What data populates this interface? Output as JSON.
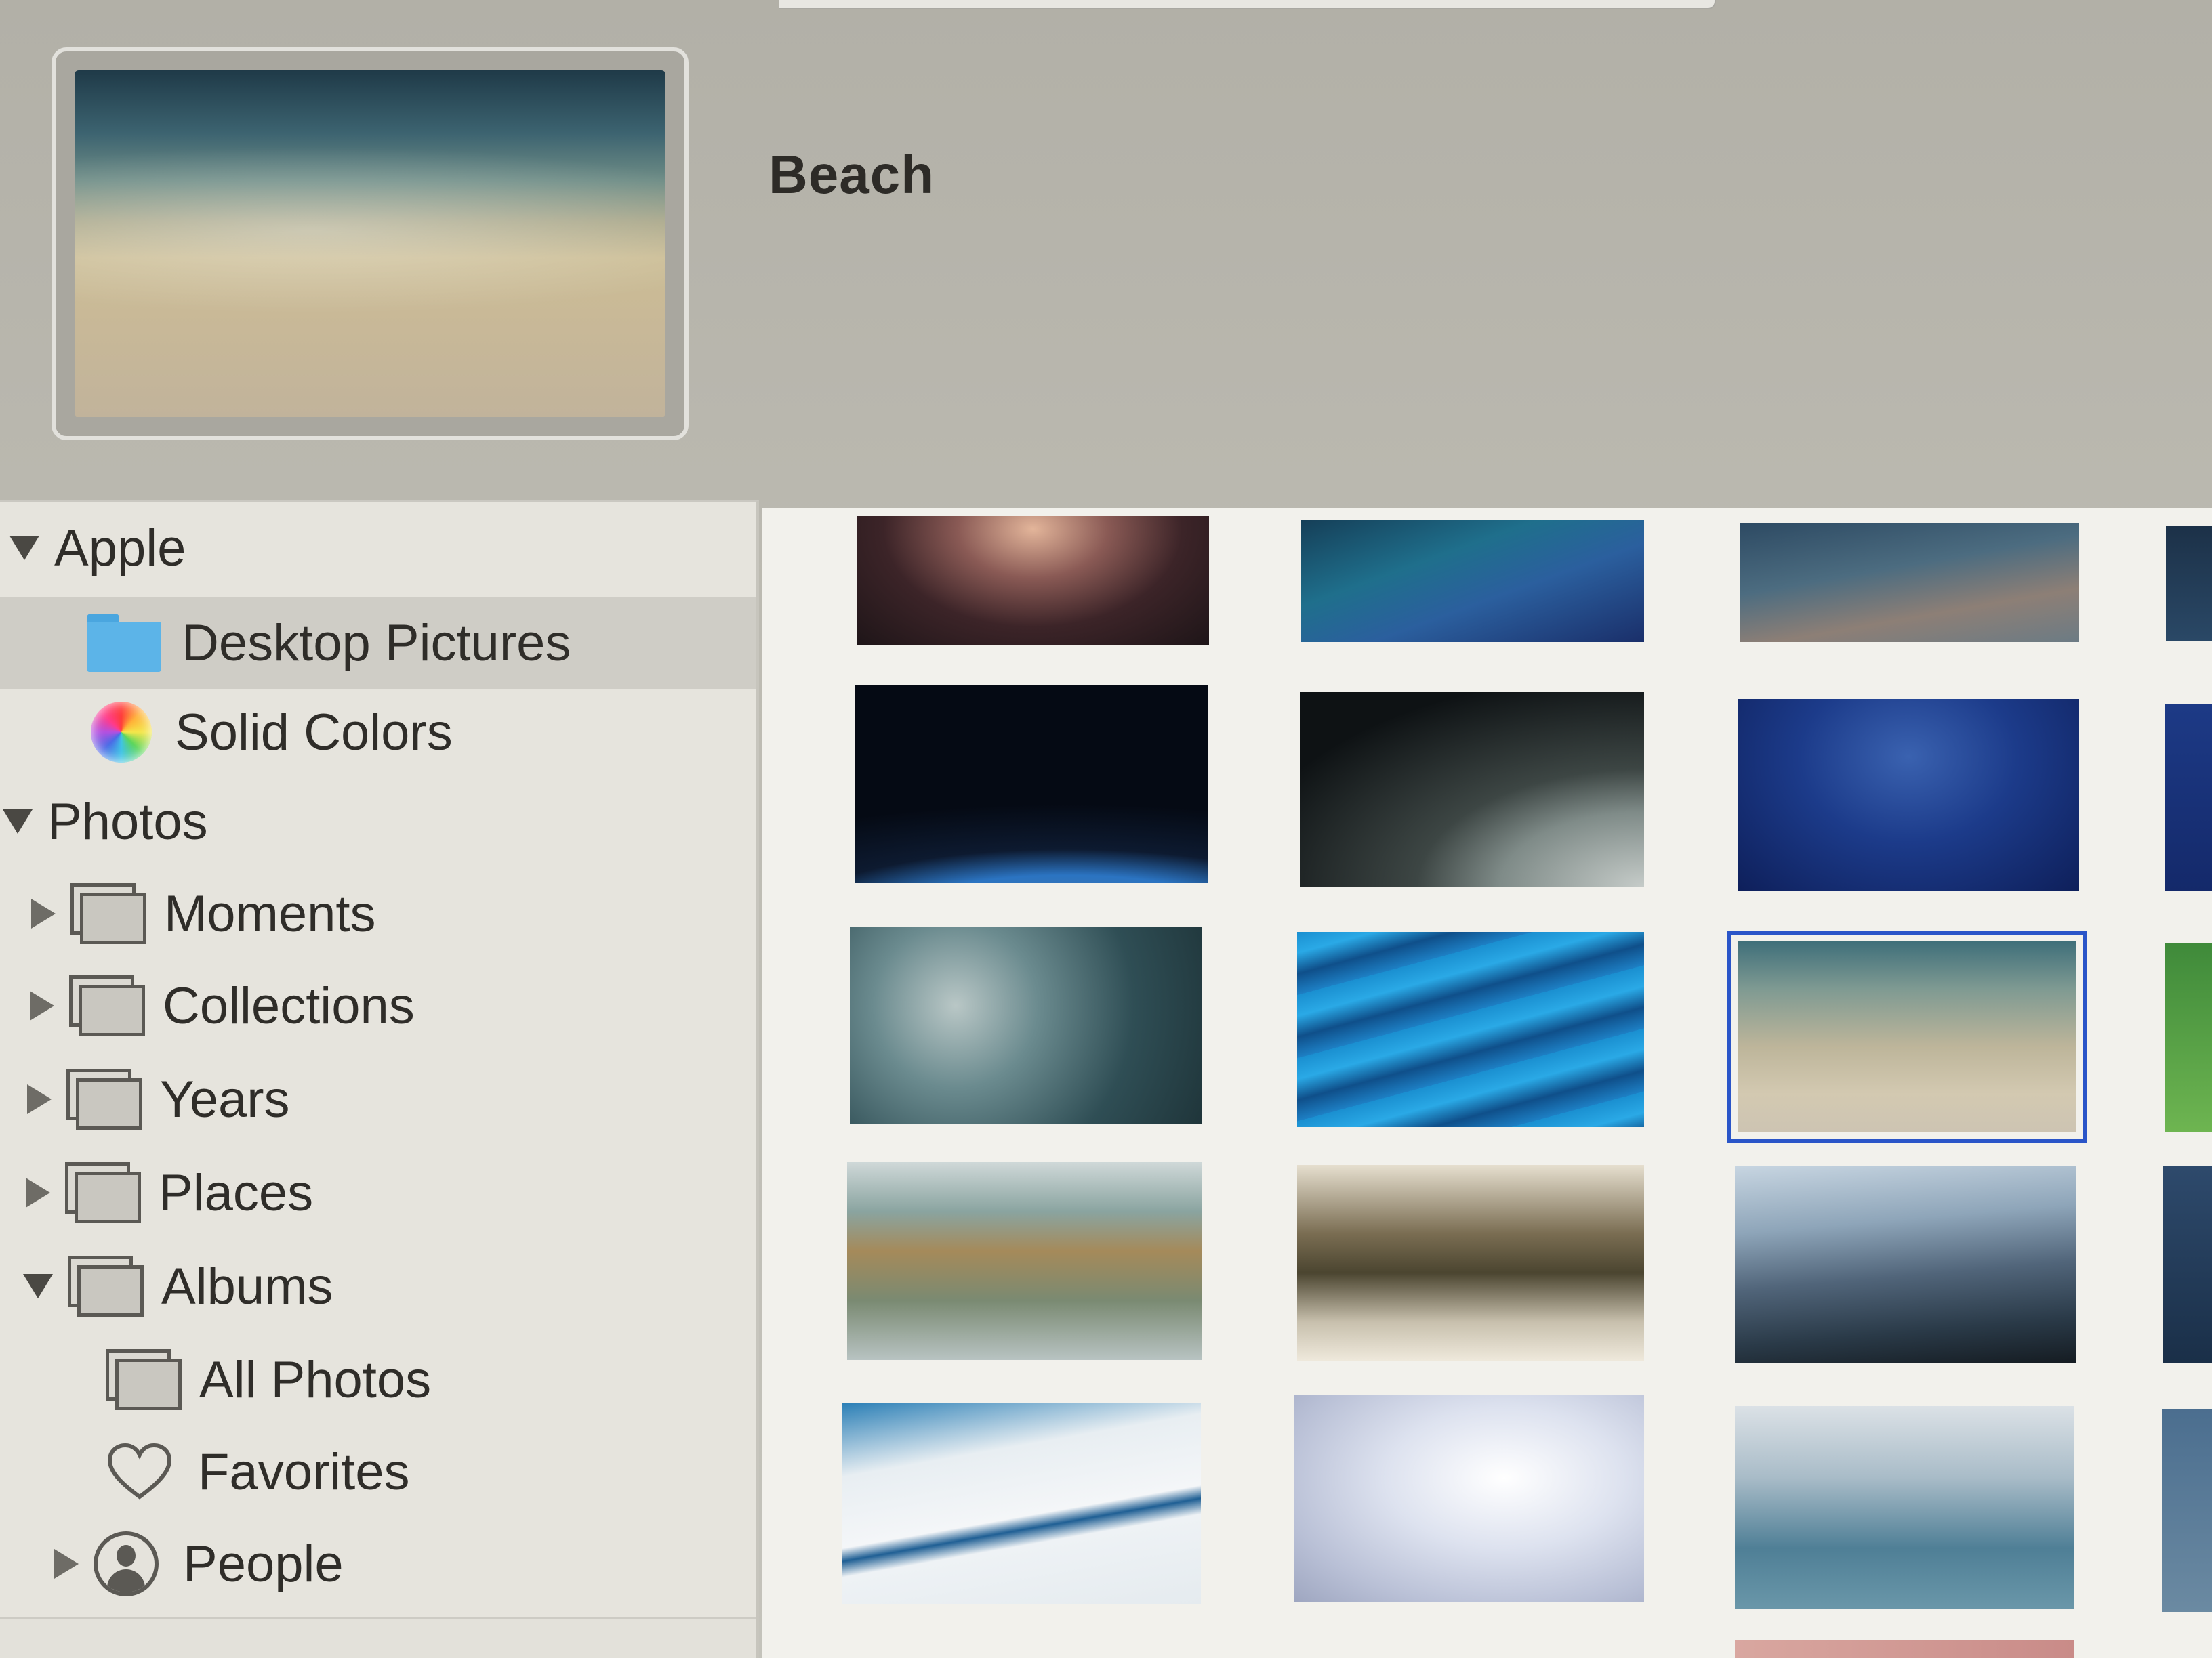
{
  "preview": {
    "wallpaper_name": "Beach"
  },
  "sidebar": {
    "apple": {
      "label": "Apple",
      "items": [
        {
          "label": "Desktop Pictures",
          "icon": "folder-icon",
          "selected": true
        },
        {
          "label": "Solid Colors",
          "icon": "color-wheel-icon",
          "selected": false
        }
      ]
    },
    "photos": {
      "label": "Photos",
      "items": [
        {
          "label": "Moments",
          "icon": "photo-stack-icon"
        },
        {
          "label": "Collections",
          "icon": "photo-stack-icon"
        },
        {
          "label": "Years",
          "icon": "photo-stack-icon"
        },
        {
          "label": "Places",
          "icon": "photo-stack-icon"
        },
        {
          "label": "Albums",
          "icon": "photo-stack-icon"
        }
      ],
      "albums": [
        {
          "label": "All Photos",
          "icon": "photo-stack-icon"
        },
        {
          "label": "Favorites",
          "icon": "heart-icon"
        },
        {
          "label": "People",
          "icon": "person-icon"
        }
      ]
    }
  },
  "grid": {
    "thumbnails": [
      {
        "name": "desert-night-rocks",
        "selected": false
      },
      {
        "name": "blue-wave",
        "selected": false
      },
      {
        "name": "dusk-coast",
        "selected": false
      },
      {
        "name": "earth-horizon-moon",
        "selected": false
      },
      {
        "name": "earth-clouds",
        "selected": false
      },
      {
        "name": "milky-way",
        "selected": false
      },
      {
        "name": "clouds-aerial",
        "selected": false
      },
      {
        "name": "turquoise-river",
        "selected": false
      },
      {
        "name": "beach",
        "selected": true
      },
      {
        "name": "autumn-fog-hills",
        "selected": false
      },
      {
        "name": "foggy-forest",
        "selected": false
      },
      {
        "name": "blue-mountains",
        "selected": false
      },
      {
        "name": "ice-crack",
        "selected": false
      },
      {
        "name": "snow-drifts",
        "selected": false
      },
      {
        "name": "reflection-lake",
        "selected": false
      }
    ],
    "selection_color": "#2a55c8"
  }
}
